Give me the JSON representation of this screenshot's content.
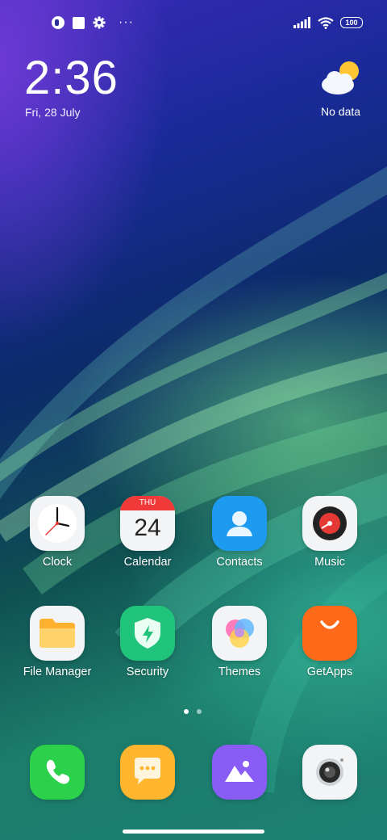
{
  "status_bar": {
    "icons_left": [
      "notification-icon",
      "square-notification-icon",
      "settings-icon",
      "more-dots-icon"
    ],
    "icons_right": [
      "signal-icon",
      "wifi-icon",
      "battery-icon"
    ],
    "battery": "100"
  },
  "clock_widget": {
    "time": "2:36",
    "date": "Fri, 28 July"
  },
  "weather_widget": {
    "icon": "partly-cloudy-icon",
    "text": "No data"
  },
  "apps": {
    "row1": [
      {
        "label": "Clock"
      },
      {
        "label": "Calendar",
        "day_name": "THU",
        "day_number": "24"
      },
      {
        "label": "Contacts"
      },
      {
        "label": "Music"
      }
    ],
    "row2": [
      {
        "label": "File Manager"
      },
      {
        "label": "Security"
      },
      {
        "label": "Themes"
      },
      {
        "label": "GetApps"
      }
    ]
  },
  "dock": [
    {
      "icon": "phone-icon"
    },
    {
      "icon": "messages-icon"
    },
    {
      "icon": "gallery-icon"
    },
    {
      "icon": "camera-icon"
    }
  ],
  "page_indicator": {
    "pages": 2,
    "current": 1
  },
  "colors": {
    "calendar_red": "#f03a3a",
    "contacts_blue": "#1d9bf0",
    "security_green": "#1fc37a",
    "getapps_orange": "#ff6a1a",
    "phone_green": "#2bd14a",
    "messages_yellow": "#ffb52e",
    "gallery_purple": "#8a5cf6"
  }
}
